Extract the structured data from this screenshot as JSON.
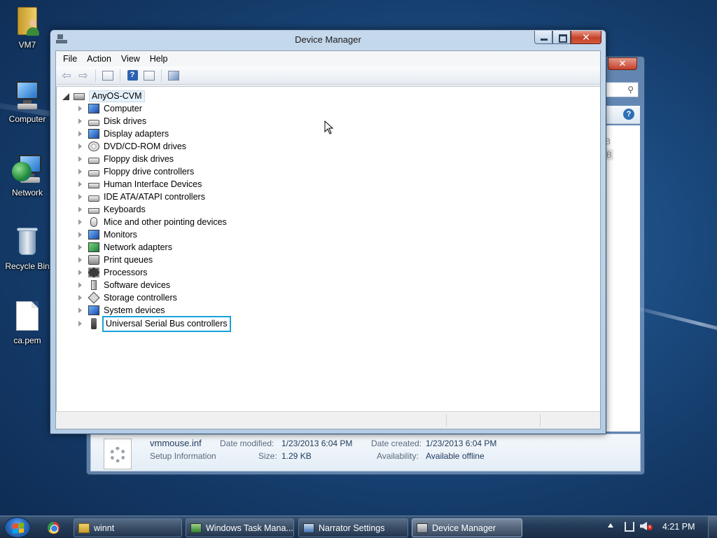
{
  "desktop": {
    "icons": [
      {
        "label": "VM7",
        "icon": "user-folder-icon"
      },
      {
        "label": "Computer",
        "icon": "computer-icon"
      },
      {
        "label": "Network",
        "icon": "network-icon"
      },
      {
        "label": "Recycle Bin",
        "icon": "recycle-bin-icon"
      },
      {
        "label": "ca.pem",
        "icon": "file-icon"
      }
    ]
  },
  "background_window": {
    "close_glyph": "✕",
    "search_glyph": "⚲",
    "help_glyph": "?",
    "partial_sizes": [
      "B",
      "B"
    ],
    "details": {
      "file_name": "vmmouse.inf",
      "file_type": "Setup Information",
      "date_modified_label": "Date modified:",
      "date_modified": "1/23/2013 6:04 PM",
      "size_label": "Size:",
      "size": "1.29 KB",
      "date_created_label": "Date created:",
      "date_created": "1/23/2013 6:04 PM",
      "availability_label": "Availability:",
      "availability": "Available offline"
    }
  },
  "device_manager": {
    "title": "Device Manager",
    "close_glyph": "✕",
    "menu": [
      "File",
      "Action",
      "View",
      "Help"
    ],
    "toolbar_help_glyph": "?",
    "tree": {
      "root": "AnyOS-CVM",
      "items": [
        {
          "label": "Computer",
          "icon": "computer-icon"
        },
        {
          "label": "Disk drives",
          "icon": "disk-drive-icon"
        },
        {
          "label": "Display adapters",
          "icon": "display-adapter-icon"
        },
        {
          "label": "DVD/CD-ROM drives",
          "icon": "dvd-drive-icon"
        },
        {
          "label": "Floppy disk drives",
          "icon": "floppy-drive-icon"
        },
        {
          "label": "Floppy drive controllers",
          "icon": "floppy-controller-icon"
        },
        {
          "label": "Human Interface Devices",
          "icon": "hid-icon"
        },
        {
          "label": "IDE ATA/ATAPI controllers",
          "icon": "ide-controller-icon"
        },
        {
          "label": "Keyboards",
          "icon": "keyboard-icon"
        },
        {
          "label": "Mice and other pointing devices",
          "icon": "mouse-icon"
        },
        {
          "label": "Monitors",
          "icon": "monitor-icon"
        },
        {
          "label": "Network adapters",
          "icon": "network-adapter-icon"
        },
        {
          "label": "Print queues",
          "icon": "printer-icon"
        },
        {
          "label": "Processors",
          "icon": "processor-icon"
        },
        {
          "label": "Software devices",
          "icon": "software-device-icon"
        },
        {
          "label": "Storage controllers",
          "icon": "storage-controller-icon"
        },
        {
          "label": "System devices",
          "icon": "system-device-icon"
        },
        {
          "label": "Universal Serial Bus controllers",
          "icon": "usb-icon",
          "selected": true
        }
      ]
    }
  },
  "taskbar": {
    "apps": [
      {
        "label": "winnt",
        "icon": "folder-icon"
      },
      {
        "label": "Windows Task Mana...",
        "icon": "task-manager-icon"
      },
      {
        "label": "Narrator Settings",
        "icon": "narrator-icon"
      },
      {
        "label": "Device Manager",
        "icon": "device-manager-icon",
        "active": true
      }
    ],
    "clock": "4:21 PM"
  },
  "colors": {
    "selection_outline": "#1aa1d8",
    "close_button": "#c4422a",
    "taskbar": "#233a57"
  }
}
